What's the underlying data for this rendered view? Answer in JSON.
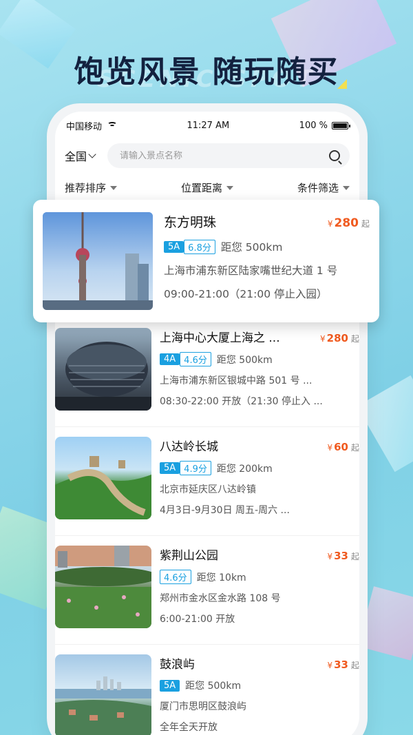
{
  "promo": {
    "title": "饱览风景 随玩随买",
    "subtitle": "SCENIC SPOT"
  },
  "status_bar": {
    "carrier": "中国移动",
    "time": "11:27 AM",
    "battery": "100 %"
  },
  "search": {
    "region": "全国",
    "placeholder": "请输入景点名称"
  },
  "filters": {
    "sort": "推荐排序",
    "distance": "位置距离",
    "condition": "条件筛选"
  },
  "featured": {
    "name": "东方明珠",
    "price": "280",
    "currency": "¥",
    "price_suffix": "起",
    "level": "5A",
    "score": "6.8分",
    "distance": "距您 500km",
    "address": "上海市浦东新区陆家嘴世纪大道 1 号",
    "hours": "09:00-21:00（21:00 停止入园）"
  },
  "items": [
    {
      "name": "上海中心大厦上海之 ...",
      "price": "280",
      "currency": "¥",
      "price_suffix": "起",
      "level": "4A",
      "score": "4.6分",
      "distance": "距您 500km",
      "address": "上海市浦东新区银城中路 501 号 ...",
      "hours": "08:30-22:00 开放（21:30 停止入 ..."
    },
    {
      "name": "八达岭长城",
      "price": "60",
      "currency": "¥",
      "price_suffix": "起",
      "level": "5A",
      "score": "4.9分",
      "distance": "距您 200km",
      "address": "北京市延庆区八达岭镇",
      "hours": "4月3日-9月30日 周五-周六 ..."
    },
    {
      "name": "紫荆山公园",
      "price": "33",
      "currency": "¥",
      "price_suffix": "起",
      "level": "",
      "score": "4.6分",
      "distance": "距您 10km",
      "address": "郑州市金水区金水路 108 号",
      "hours": "6:00-21:00 开放"
    },
    {
      "name": "鼓浪屿",
      "price": "33",
      "currency": "¥",
      "price_suffix": "起",
      "level": "5A",
      "score": "",
      "distance": "距您 500km",
      "address": "厦门市思明区鼓浪屿",
      "hours": "全年全天开放"
    }
  ],
  "colors": {
    "accent": "#1aa0e0",
    "price": "#f05a1f",
    "background": "#8fd7ea",
    "title": "#13213f"
  }
}
